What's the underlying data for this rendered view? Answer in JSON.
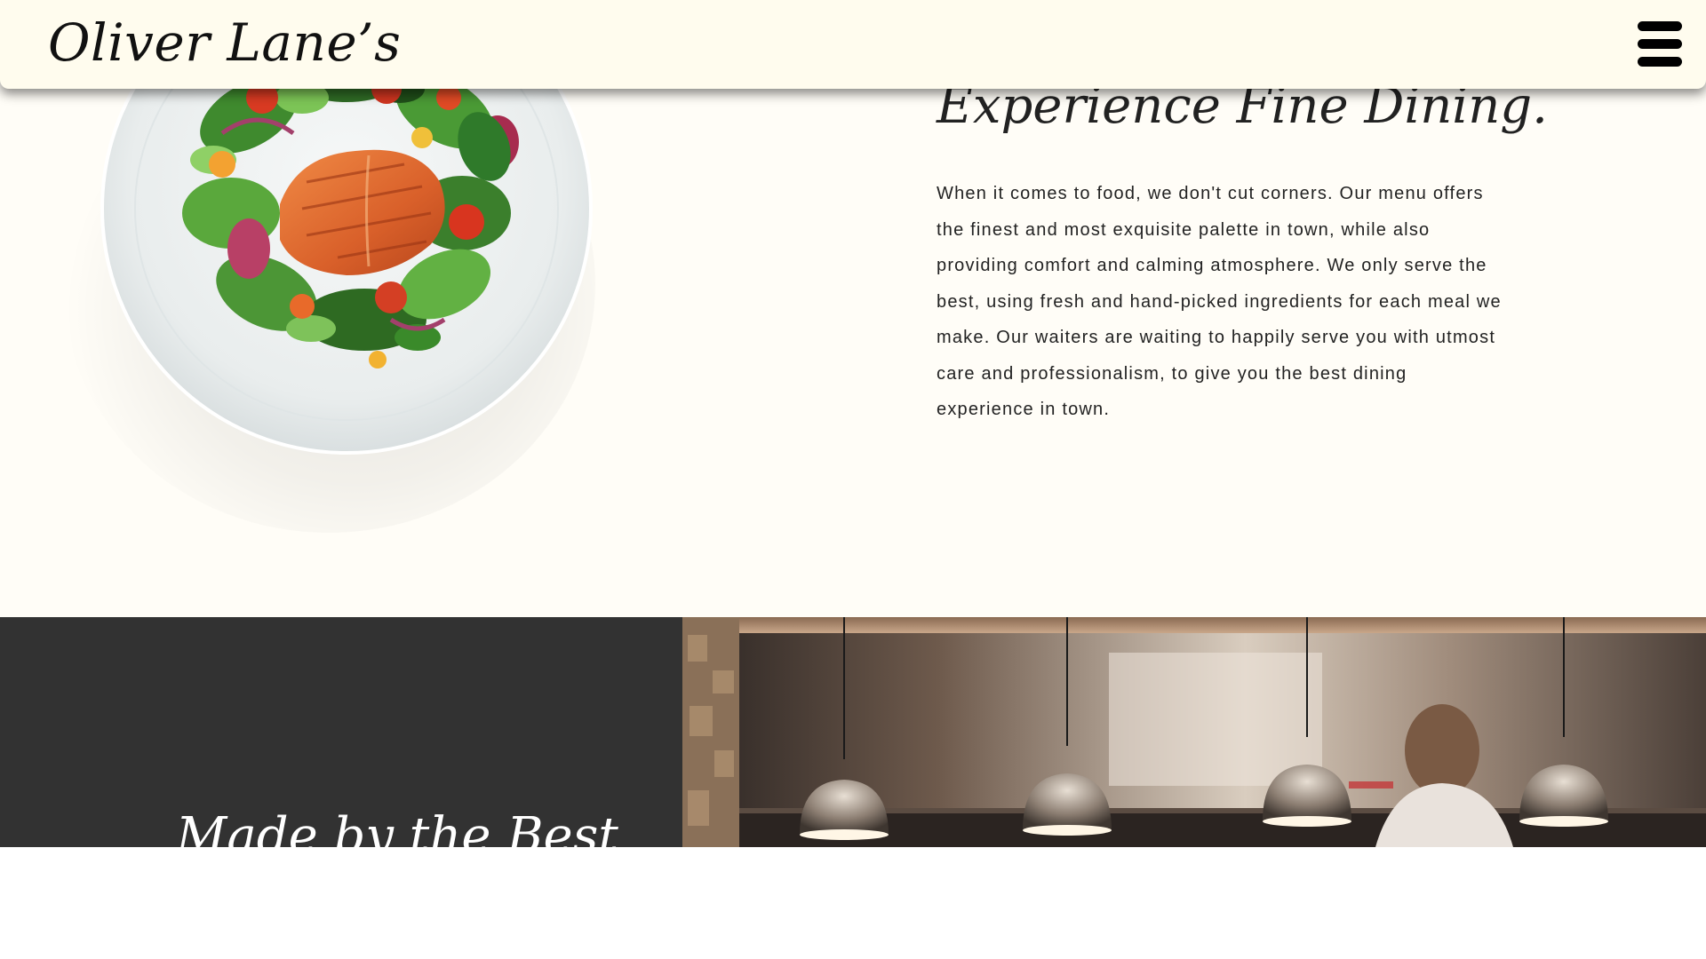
{
  "header": {
    "brand": "Oliver Lane’s",
    "menu_icon": "hamburger-menu-icon"
  },
  "intro": {
    "title": "Experience Fine Dining.",
    "body": "When it comes to food, we don't cut corners. Our menu offers the finest and most exquisite palette in town, while also providing comfort and calming atmosphere. We only serve the best, using fresh and hand-picked ingredients for each meal we make. Our waiters are waiting to happily serve you with utmost care and professionalism, to give you the best dining experience in town."
  },
  "chef_section": {
    "title": "Made by the Best"
  },
  "colors": {
    "header_bg": "#fffcee",
    "page_bg": "#fffdf7",
    "dark_band": "#323232",
    "text": "#222222"
  }
}
